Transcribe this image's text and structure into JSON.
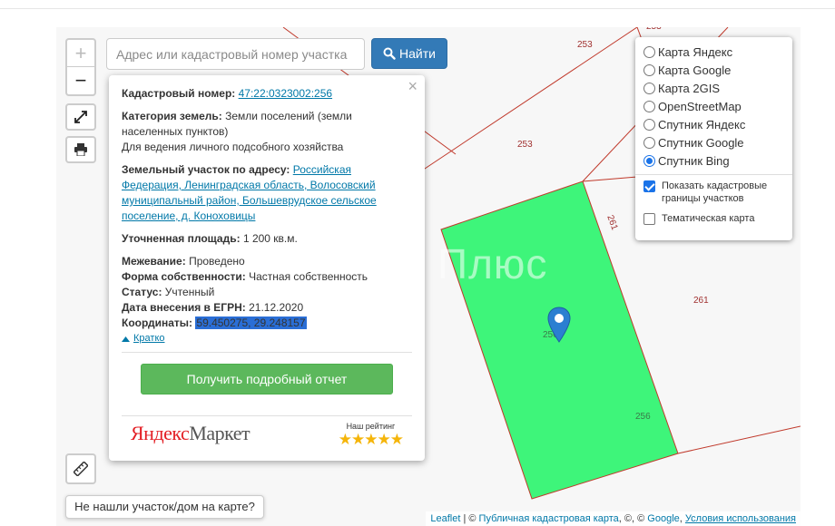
{
  "search": {
    "placeholder": "Адрес или кадастровый номер участка",
    "button_label": "Найти"
  },
  "zoom": {
    "in_label": "+",
    "out_label": "−"
  },
  "icons": {
    "search": "magnifier-icon",
    "fullscreen": "expand-icon",
    "print": "printer-icon",
    "ruler": "ruler-icon",
    "close": "close-icon",
    "collapse": "triangle-up-icon",
    "marker": "map-marker-icon"
  },
  "popup": {
    "close_label": "×",
    "cadastral_label": "Кадастровый номер:",
    "cadastral_value": "47:22:0323002:256",
    "category_label": "Категория земель:",
    "category_value": "Земли поселений (земли населенных пунктов)",
    "usage_value": "Для ведения личного подсобного хозяйства",
    "address_label": "Земельный участок по адресу:",
    "address_value": "Российская Федерация, Ленинградская область, Волосовский муниципальный район, Большеврудское сельское поселение, д. Коноховицы",
    "area_label": "Уточненная площадь:",
    "area_value": "1 200 кв.м.",
    "survey_label": "Межевание:",
    "survey_value": "Проведено",
    "ownership_label": "Форма собственности:",
    "ownership_value": "Частная собственность",
    "status_label": "Статус:",
    "status_value": "Учтенный",
    "egrn_label": "Дата внесения в ЕГРН:",
    "egrn_value": "21.12.2020",
    "coords_label": "Координаты:",
    "coords_value": "59.450275, 29.248157",
    "collapse_label": "Кратко",
    "report_button": "Получить подробный отчет",
    "market_logo_ya": "Яндекс",
    "market_logo_market": "Маркет",
    "rating_label": "Наш рейтинг",
    "rating_stars": "★★★★★",
    "rating_value": 5
  },
  "layers": {
    "options": [
      {
        "label": "Карта Яндекс",
        "selected": false
      },
      {
        "label": "Карта Google",
        "selected": false
      },
      {
        "label": "Карта 2GIS",
        "selected": false
      },
      {
        "label": "OpenStreetMap",
        "selected": false
      },
      {
        "label": "Спутник Яндекс",
        "selected": false
      },
      {
        "label": "Спутник Google",
        "selected": false
      },
      {
        "label": "Спутник Bing",
        "selected": true
      }
    ],
    "checkboxes": [
      {
        "label": "Показать кадастровые границы участков",
        "checked": true
      },
      {
        "label": "Тематическая карта",
        "checked": false
      }
    ]
  },
  "map": {
    "watermark": "Плюс",
    "parcel_labels": [
      "253",
      "253",
      "261",
      "261",
      "256",
      "256",
      "253"
    ],
    "highlight_color": "#3ef57a",
    "boundary_color": "#c0392b"
  },
  "not_found_button": "Не нашли участок/дом на карте?",
  "attribution": {
    "leaflet": "Leaflet",
    "sep1": " | © ",
    "pkk": "Публичная кадастровая карта",
    "sep2": ", ©, © ",
    "google": "Google",
    "sep3": ", ",
    "terms": "Условия использования"
  }
}
